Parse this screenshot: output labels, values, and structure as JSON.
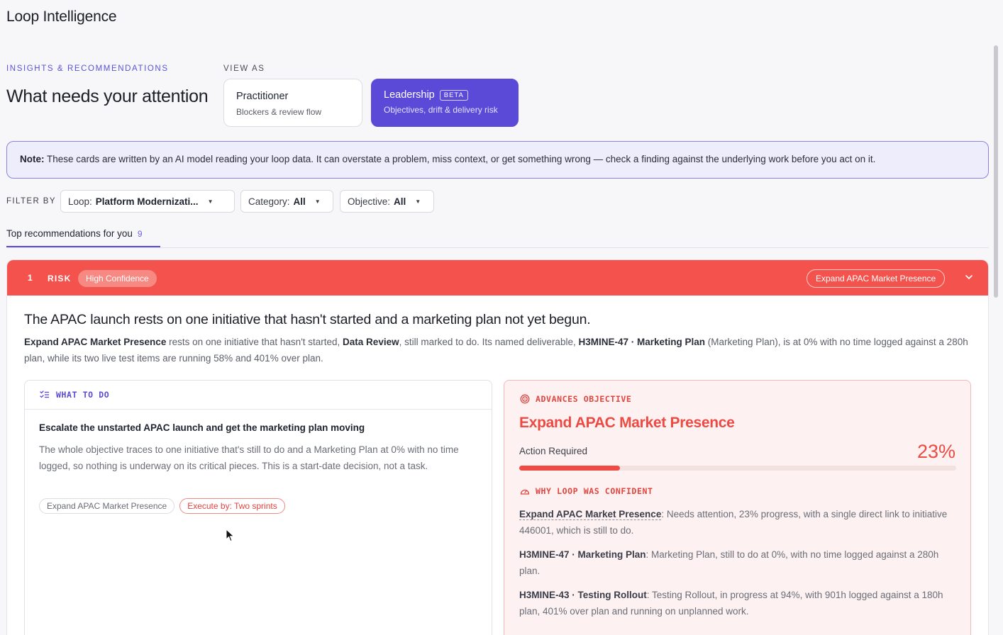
{
  "app": {
    "title": "Loop Intelligence"
  },
  "intro": {
    "eyebrow": "INSIGHTS & RECOMMENDATIONS",
    "headline": "What needs your attention"
  },
  "view_as": {
    "label": "VIEW AS",
    "options": [
      {
        "title": "Practitioner",
        "subtitle": "Blockers & review flow",
        "selected": false
      },
      {
        "title": "Leadership",
        "badge": "BETA",
        "subtitle": "Objectives, drift & delivery risk",
        "selected": true
      }
    ]
  },
  "note": {
    "label": "Note:",
    "text": "These cards are written by an AI model reading your loop data. It can overstate a problem, miss context, or get something wrong — check a finding against the underlying work before you act on it."
  },
  "filters": {
    "label": "FILTER BY",
    "loop": {
      "label": "Loop:",
      "value": "Platform Modernizati..."
    },
    "category": {
      "label": "Category:",
      "value": "All"
    },
    "objective": {
      "label": "Objective:",
      "value": "All"
    }
  },
  "tabs": {
    "top_label": "Top recommendations for you",
    "top_count": "9"
  },
  "recommendation": {
    "number": "1",
    "kind": "RISK",
    "confidence": "High Confidence",
    "objective_pill": "Expand APAC Market Presence",
    "header_color": "#f4534d",
    "title": "The APAC launch rests on one initiative that hasn't started and a marketing plan not yet begun.",
    "body": {
      "b1": "Expand APAC Market Presence",
      "t1": " rests on one initiative that hasn't started, ",
      "b2": "Data Review",
      "t2": ", still marked to do. Its named deliverable, ",
      "b3": "H3MINE-47 · Marketing Plan",
      "t3": " (Marketing Plan), is at 0% with no time logged against a 280h plan, while its two live test items are running 58% and 401% over plan."
    },
    "what_to_do": {
      "heading": "WHAT TO DO",
      "title": "Escalate the unstarted APAC launch and get the marketing plan moving",
      "description": "The whole objective traces to one initiative that's still to do and a Marketing Plan at 0% with no time logged, so nothing is underway on its critical pieces. This is a start-date decision, not a task.",
      "tags": [
        "Expand APAC Market Presence",
        "Execute by: Two sprints"
      ]
    },
    "objective": {
      "heading": "ADVANCES OBJECTIVE",
      "name": "Expand APAC Market Presence",
      "status": "Action Required",
      "progress_pct": "23%",
      "progress_fraction": 0.23,
      "accent_color": "#ec4a43",
      "confidence_heading": "WHY LOOP WAS CONFIDENT",
      "evidence": [
        {
          "ref": "Expand APAC Market Presence",
          "text": ": Needs attention, 23% progress, with a single direct link to initiative 446001, which is still to do."
        },
        {
          "ref": "H3MINE-47 · Marketing Plan",
          "text": ": Marketing Plan, still to do at 0%, with no time logged against a 280h plan."
        },
        {
          "ref": "H3MINE-43 · Testing Rollout",
          "text": ": Testing Rollout, in progress at 94%, with 901h logged against a 180h plan, 401% over plan and running on unplanned work."
        }
      ]
    }
  }
}
